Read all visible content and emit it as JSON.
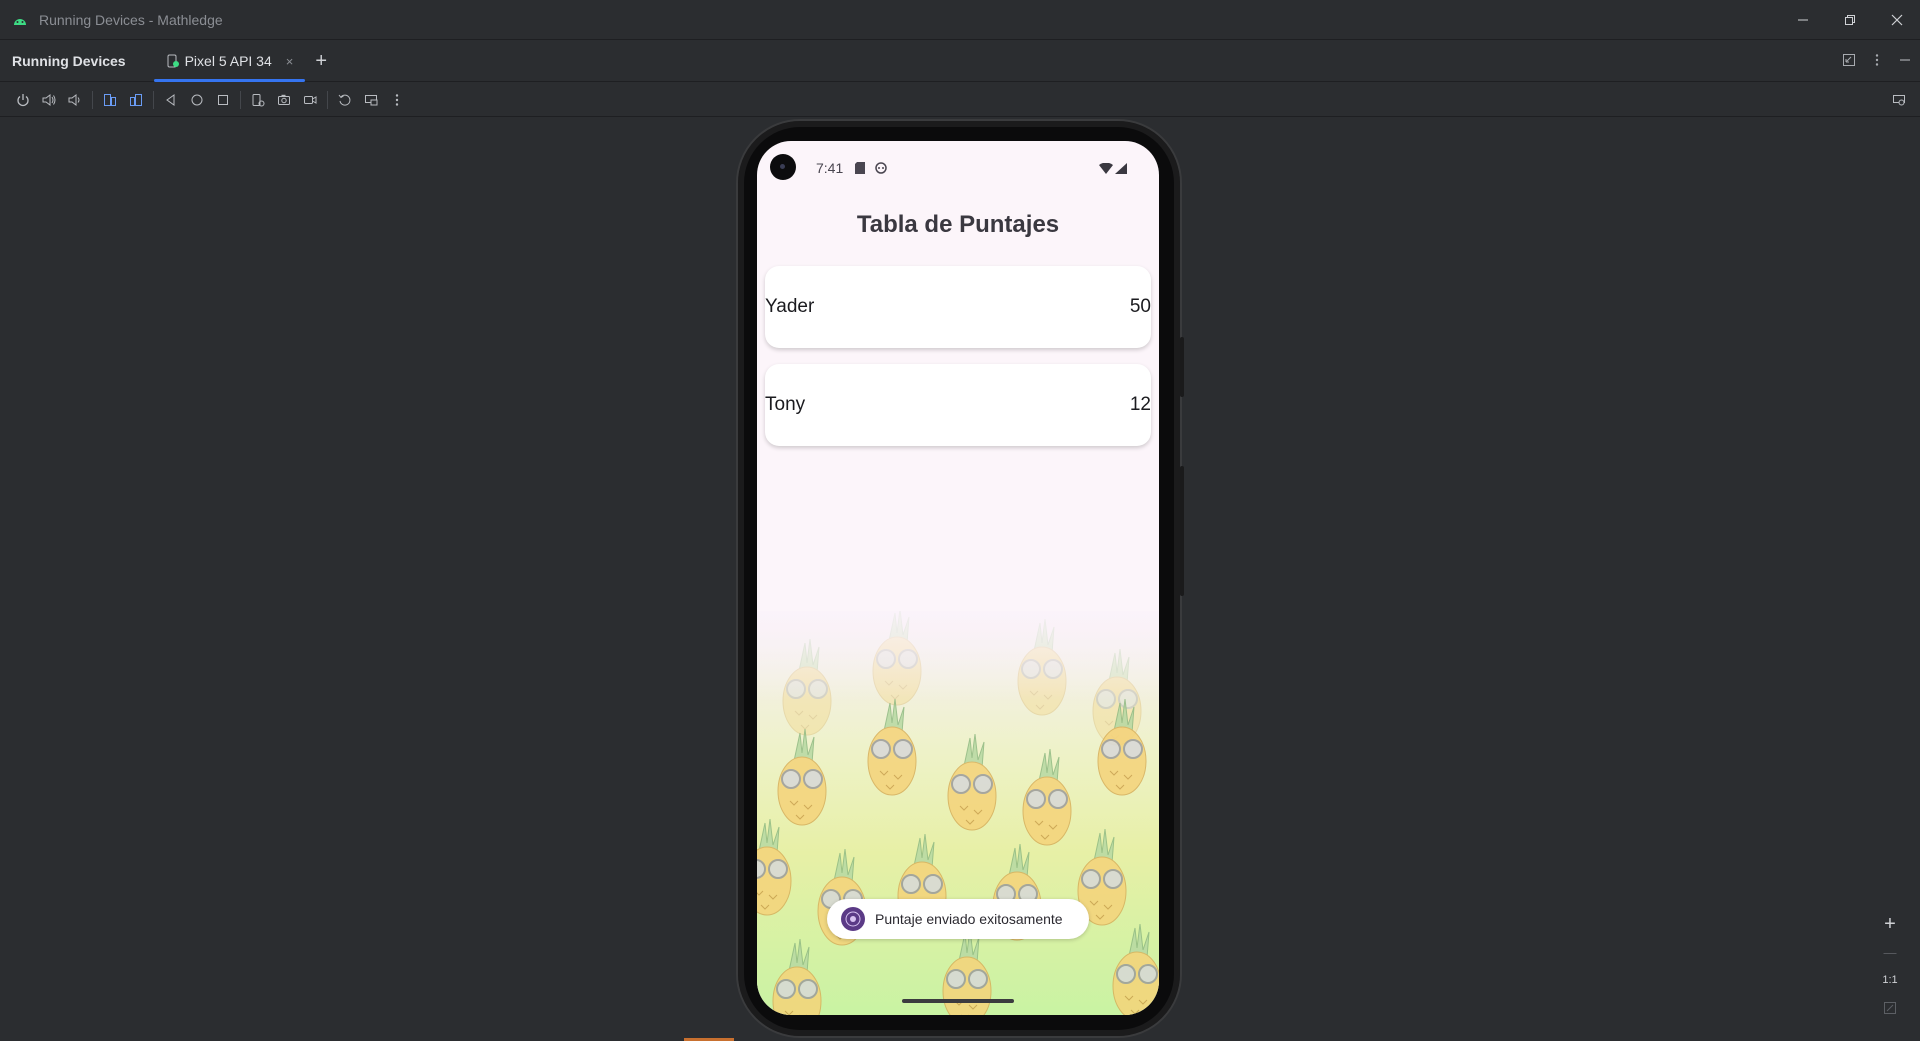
{
  "window": {
    "title": "Running Devices - Mathledge",
    "controls": [
      "minimize-icon",
      "restore-icon",
      "close-icon"
    ]
  },
  "tabstrip": {
    "panel_title": "Running Devices",
    "tab_label": "Pixel 5 API 34",
    "tab_close": "×",
    "add": "+"
  },
  "toolbar": {
    "icons": [
      "power-icon",
      "volume-up-icon",
      "volume-down-icon",
      "rotate-left-icon",
      "rotate-right-icon",
      "back-icon",
      "home-icon",
      "overview-icon",
      "device-frame-icon",
      "camera-icon",
      "record-icon",
      "reset-icon",
      "snapshot-icon",
      "more-icon"
    ]
  },
  "device": {
    "status_time": "7:41",
    "screen_title": "Tabla de Puntajes",
    "scores": [
      {
        "name": "Yader",
        "score": "50"
      },
      {
        "name": "Tony",
        "score": "12"
      }
    ],
    "toast": "Puntaje enviado exitosamente"
  },
  "zoom": {
    "zoom_in": "+",
    "zoom_out": "—",
    "actual_size": "1:1"
  },
  "colors": {
    "accent": "#3574f0",
    "ide_bg": "#2b2d30",
    "screen_bg": "#fcf5fa"
  }
}
